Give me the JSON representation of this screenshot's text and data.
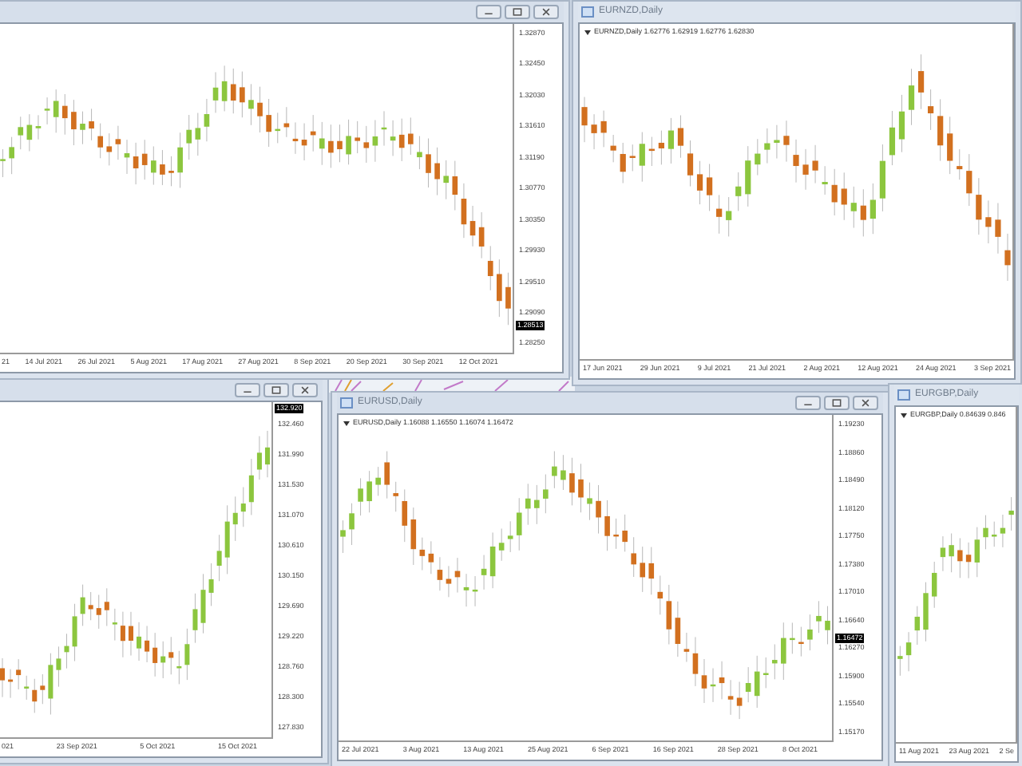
{
  "windows": [
    {
      "window_buttons": true,
      "price_ticks": [
        "1.32870",
        "1.32450",
        "1.32030",
        "1.31610",
        "1.31190",
        "1.30770",
        "1.30350",
        "1.29930",
        "1.29510",
        "1.29090",
        "1.28250"
      ],
      "current_price": "1.28513",
      "date_ticks": [
        "21",
        "14 Jul 2021",
        "26 Jul 2021",
        "5 Aug 2021",
        "17 Aug 2021",
        "27 Aug 2021",
        "8 Sep 2021",
        "20 Sep 2021",
        "30 Sep 2021",
        "12 Oct 2021"
      ]
    },
    {
      "title": "EURNZD,Daily",
      "info": "EURNZD,Daily  1.62776 1.62919 1.62776 1.62830",
      "window_buttons": false,
      "date_ticks": [
        "17 Jun 2021",
        "29 Jun 2021",
        "9 Jul 2021",
        "21 Jul 2021",
        "2 Aug 2021",
        "12 Aug 2021",
        "24 Aug 2021",
        "3 Sep 2021"
      ]
    },
    {
      "window_buttons": true,
      "price_ticks": [
        "132.460",
        "131.990",
        "131.530",
        "131.070",
        "130.610",
        "130.150",
        "129.690",
        "129.220",
        "128.760",
        "128.300",
        "127.830"
      ],
      "current_price": "132.920",
      "date_ticks": [
        "021",
        "23 Sep 2021",
        "5 Oct 2021",
        "15 Oct 2021"
      ]
    },
    {
      "title": "EURUSD,Daily",
      "info": "EURUSD,Daily  1.16088 1.16550 1.16074 1.16472",
      "window_buttons": true,
      "price_ticks": [
        "1.19230",
        "1.18860",
        "1.18490",
        "1.18120",
        "1.17750",
        "1.17380",
        "1.17010",
        "1.16640",
        "1.16270",
        "1.15900",
        "1.15540",
        "1.15170"
      ],
      "current_price": "1.16472",
      "date_ticks": [
        "22 Jul 2021",
        "3 Aug 2021",
        "13 Aug 2021",
        "25 Aug 2021",
        "6 Sep 2021",
        "16 Sep 2021",
        "28 Sep 2021",
        "8 Oct 2021"
      ]
    },
    {
      "title": "EURGBP,Daily",
      "info": "EURGBP,Daily  0.84639 0.846",
      "window_buttons": false,
      "date_ticks": [
        "11 Aug 2021",
        "23 Aug 2021",
        "2 Se"
      ]
    }
  ]
}
